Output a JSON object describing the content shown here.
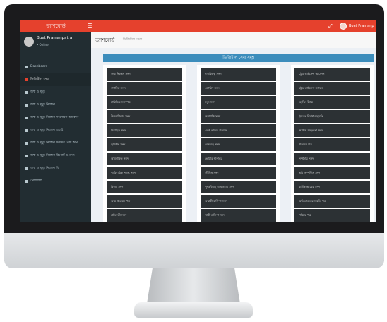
{
  "topbar": {
    "brand": "ড্যাশবোর্ড",
    "menu_icon": "menu-icon",
    "expand_icon": "expand-icon",
    "user_name": "Buet Pramanpatra"
  },
  "sidebar": {
    "user_name": "Buet Pramanpatra",
    "user_status": "• Online",
    "items": [
      {
        "label": "Dashboard",
        "icon": "dashboard-icon"
      },
      {
        "label": "ডিজিটাল সেবা",
        "icon": "list-icon"
      },
      {
        "label": "জন্ম ও মৃত্যু",
        "icon": "list-icon"
      },
      {
        "label": "জন্ম ও মৃত্যু নিবন্ধন",
        "icon": "list-icon"
      },
      {
        "label": "জন্ম ও মৃত্যু নিবন্ধন সংশোধন আবেদন",
        "icon": "list-icon"
      },
      {
        "label": "জন্ম ও মৃত্যু নিবন্ধন যাচাই",
        "icon": "list-icon"
      },
      {
        "label": "জন্ম ও মৃত্যু নিবন্ধন সনদের প্রিন্ট কপি",
        "icon": "list-icon"
      },
      {
        "label": "জন্ম ও মৃত্যু নিবন্ধন রিপোর্ট ও তথ্য",
        "icon": "list-icon"
      },
      {
        "label": "জন্ম ও মৃত্যু নিবন্ধন ফি",
        "icon": "list-icon"
      },
      {
        "label": "প্রোফাইল",
        "icon": "user-icon"
      }
    ]
  },
  "content": {
    "title": "ড্যাশবোর্ড",
    "subtitle": "ডিজিটাল সেবা",
    "box_title": "ডিজিটাল সেবা সমূহ",
    "columns": [
      [
        "জন্ম নিবন্ধন সনদ",
        "নাগরিক সনদ",
        "চারিত্রিক সনদপত্র",
        "উত্তরাধিকার সনদ",
        "বিবাহিত সনদ",
        "ভূমিহীন সনদ",
        "অবিবাহিত সনদ",
        "পারিবারিক সদস্য সনদ",
        "বিধবা সনদ",
        "আয় প্রত্যয়ন পত্র",
        "প্রতিবন্ধী সনদ"
      ],
      [
        "নাগরিকত্ব সনদ",
        "ওয়ারিশ সনদ",
        "মৃত্যু সনদ",
        "অনাপত্তি সনদ",
        "একই নামের প্রত্যয়ন",
        "বেকারত্ব সনদ",
        "ভোটার স্থানান্তর",
        "জীবিত সনদ",
        "পুনঃবিবাহ না হওয়ার সনদ",
        "অস্থায়ী বাসিন্দা সনদ",
        "স্থায়ী বাসিন্দা সনদ"
      ],
      [
        "ট্রেড লাইসেন্স আবেদন",
        "ট্রেড লাইসেন্স নবায়ন",
        "হোল্ডিং ট্যাক্স",
        "ইমারত নির্মাণ অনুমতি",
        "আর্থিক সচ্ছলতা সনদ",
        "প্রত্যয়ন পত্র",
        "সম্প্রদায় সনদ",
        "ভূমি সম্পর্কিত সনদ",
        "বার্ষিক আয়ের সনদ",
        "অভিভাবকের সম্মতি পত্র",
        "পরিচয় পত্র"
      ]
    ]
  }
}
